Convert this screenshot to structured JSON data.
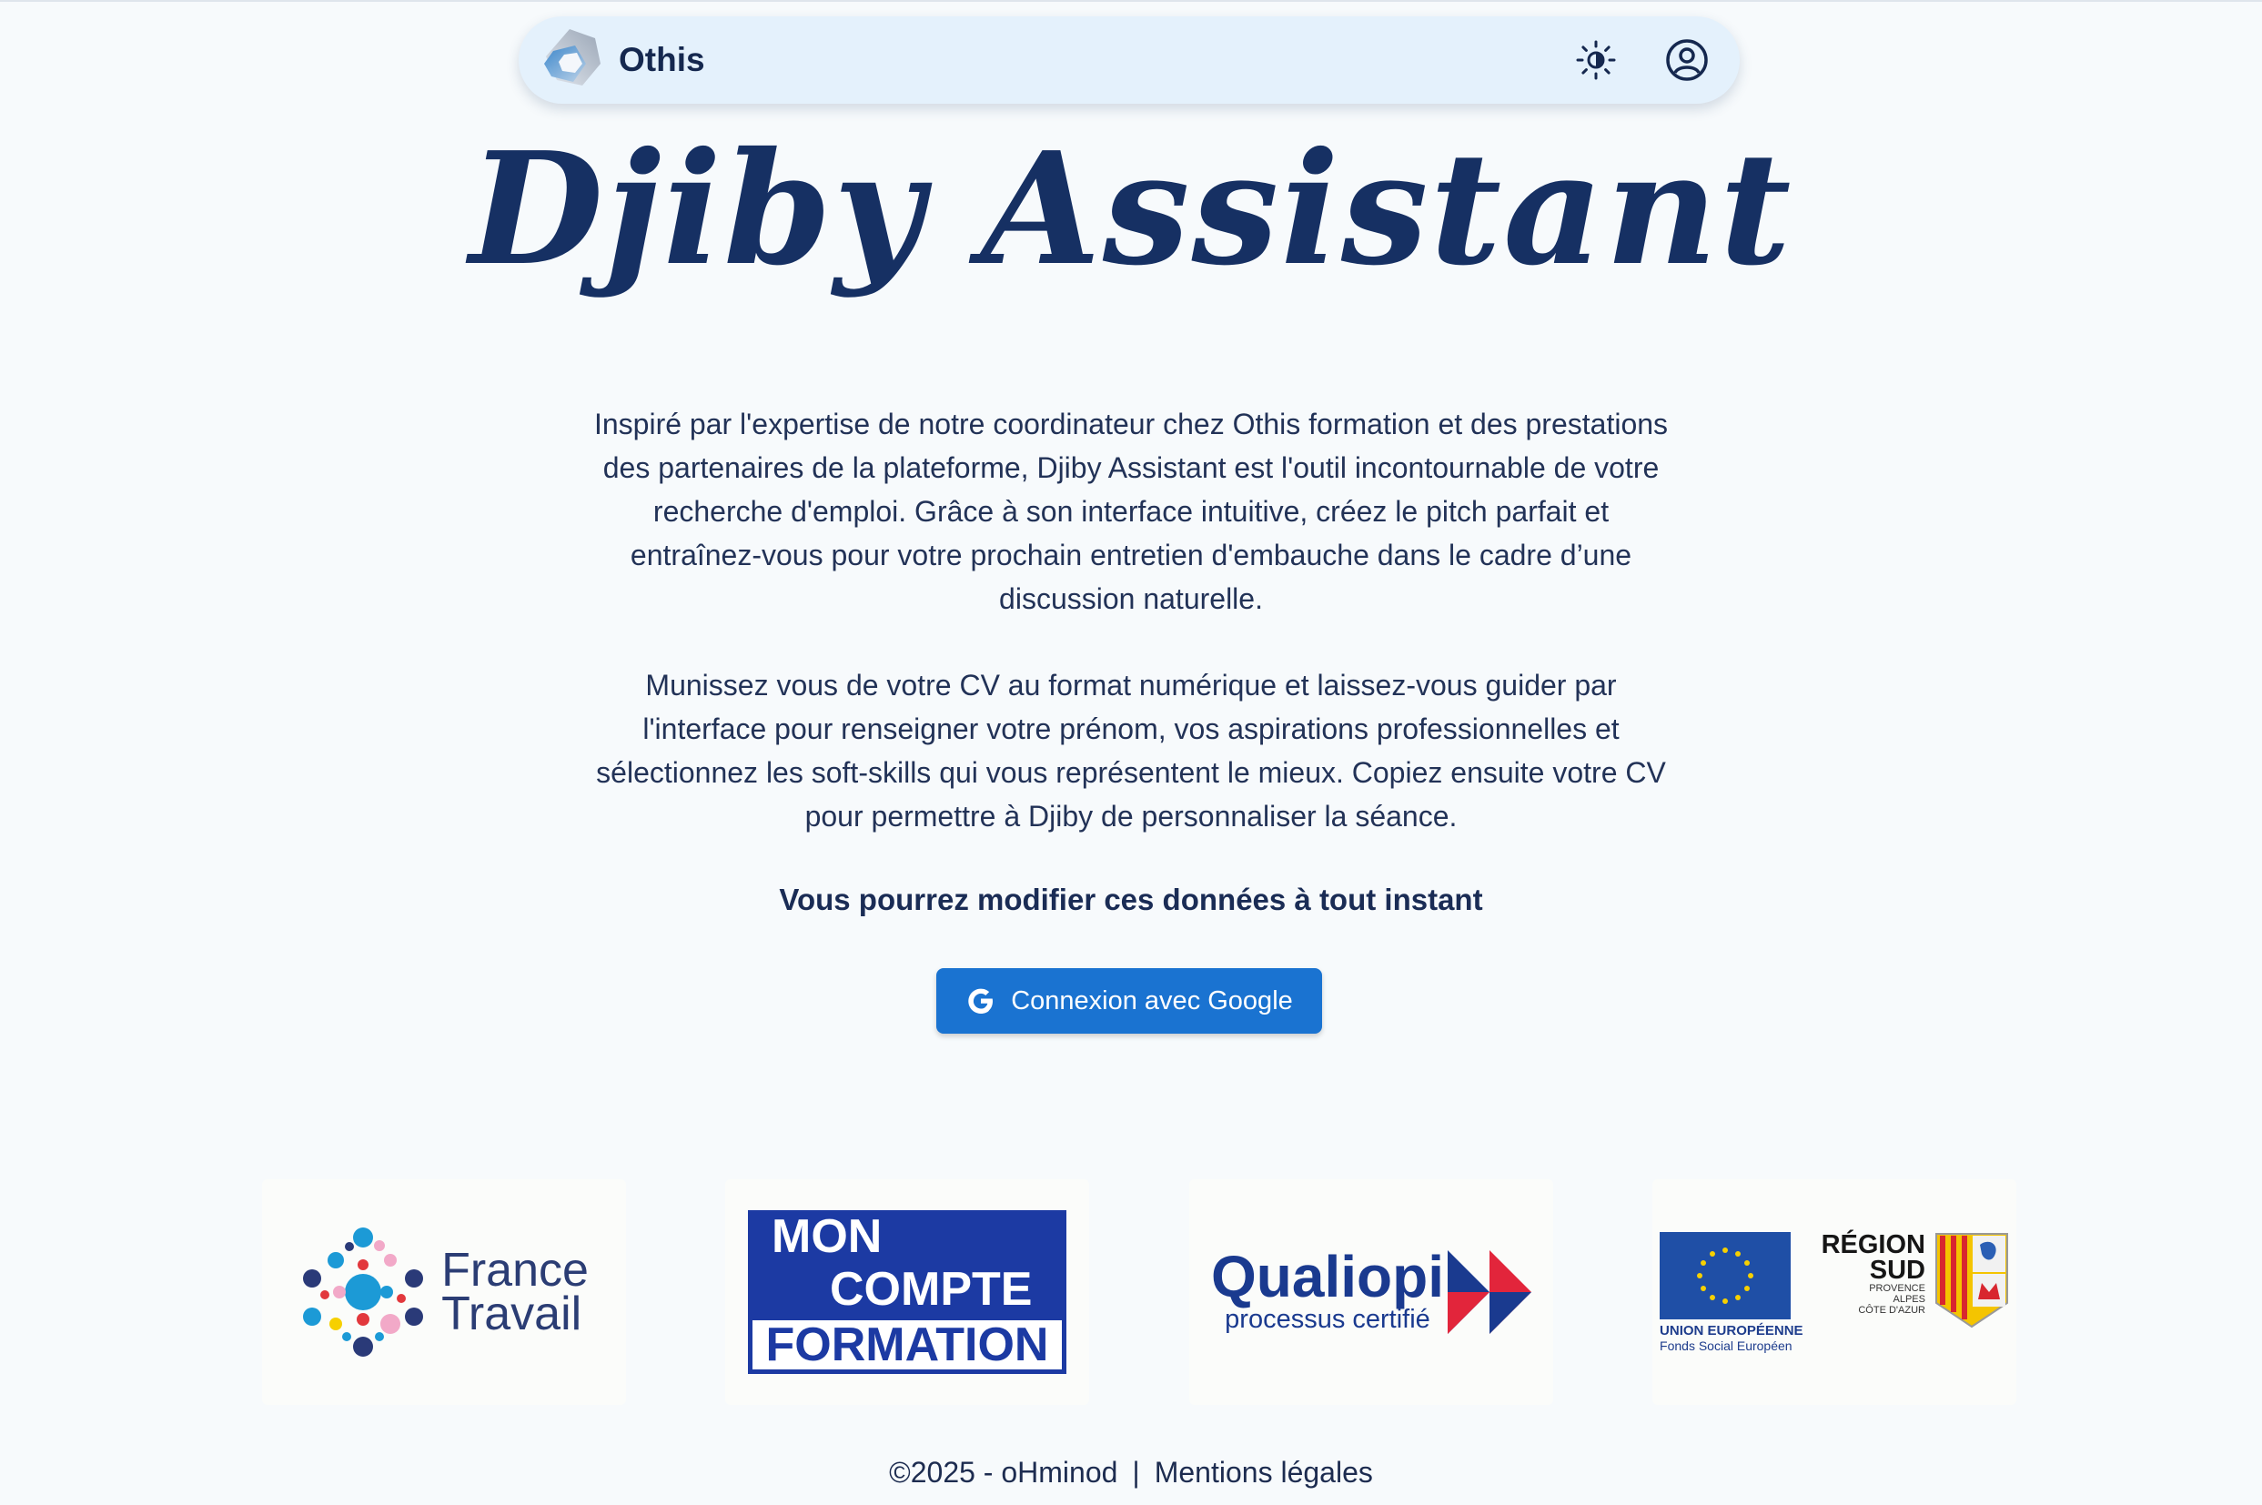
{
  "header": {
    "brand_name": "Othis",
    "theme_toggle_icon": "sun-icon",
    "account_icon": "account-circle-icon"
  },
  "hero": {
    "title": "Djiby Assistant",
    "paragraph_1": "Inspiré par l'expertise de notre coordinateur chez Othis formation et des prestations des partenaires de la plateforme, Djiby Assistant est l'outil incontournable de votre recherche d'emploi. Grâce à son interface intuitive, créez le pitch parfait et entraînez-vous pour votre prochain entretien d'embauche dans le cadre d’une discussion naturelle.",
    "paragraph_2": "Munissez vous de votre CV au format numérique et laissez-vous guider par l'interface pour renseigner votre prénom, vos aspirations professionnelles et sélectionnez les soft-skills qui vous représentent le mieux. Copiez ensuite votre CV pour permettre à Djiby de personnaliser la séance.",
    "highlight": "Vous pourrez modifier ces données à tout instant"
  },
  "login": {
    "google_button_label": "Connexion avec Google",
    "icon": "google-icon"
  },
  "partners": {
    "france_travail": [
      "France",
      "Travail"
    ],
    "mon_compte_formation": [
      "MON",
      "COMPTE",
      "FORMATION"
    ],
    "qualiopi": {
      "title": "Qualiopi",
      "subtitle": "processus certifié"
    },
    "eu": {
      "line1": "UNION EUROPÉENNE",
      "line2": "Fonds Social Européen"
    },
    "region": {
      "title_1": "RÉGION",
      "title_2": "SUD",
      "sub_1": "PROVENCE",
      "sub_2": "ALPES",
      "sub_3": "CÔTE D'AZUR"
    }
  },
  "footer": {
    "copyright": "©2025 - oHminod",
    "separator": "|",
    "legal_link": "Mentions légales"
  },
  "colors": {
    "primary": "#1a73d1",
    "navy": "#163063",
    "navbar_bg": "#e4f1fc",
    "page_bg": "#f7fafc"
  }
}
